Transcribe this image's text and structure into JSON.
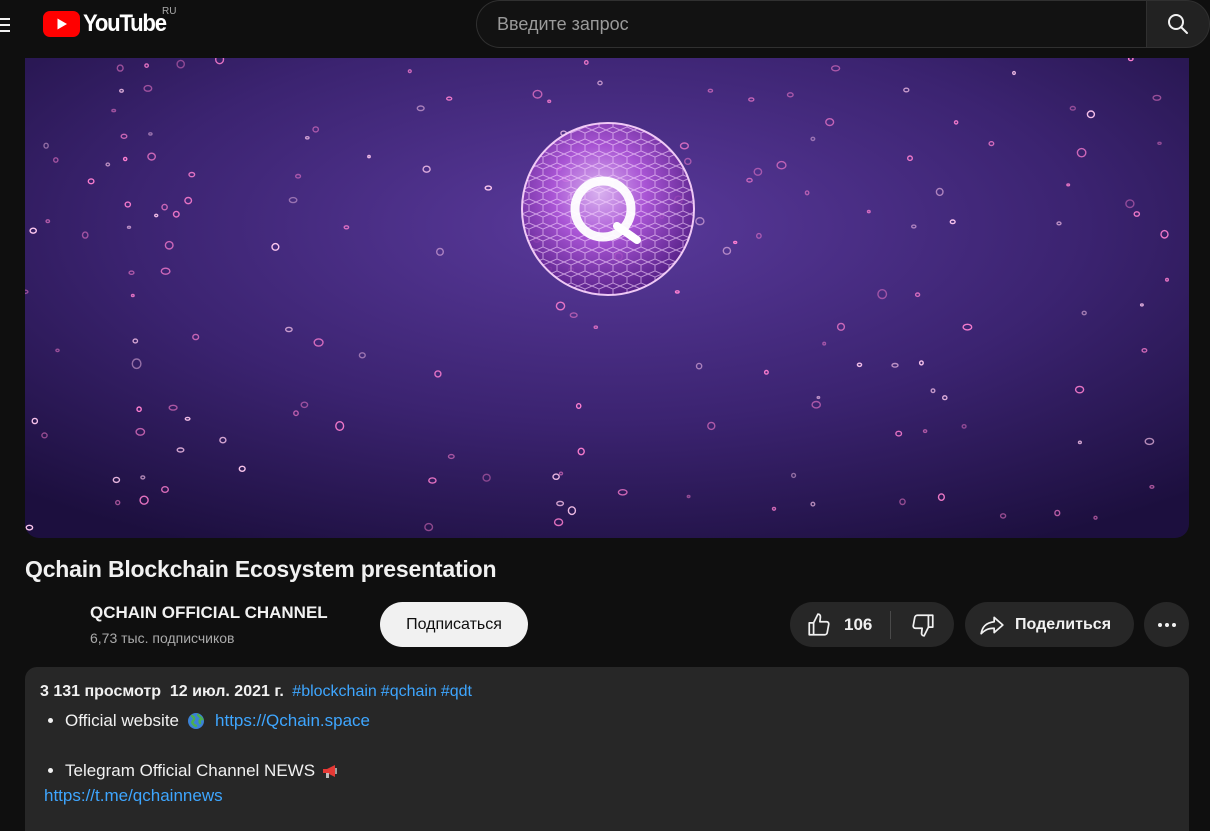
{
  "header": {
    "logo_text": "YouTube",
    "region": "RU",
    "search_placeholder": "Введите запрос"
  },
  "video": {
    "title": "Qchain Blockchain Ecosystem presentation"
  },
  "channel": {
    "name": "QCHAIN OFFICIAL CHANNEL",
    "subscribers": "6,73 тыс. подписчиков",
    "subscribe_label": "Подписаться"
  },
  "actions": {
    "like_count": "106",
    "share_label": "Поделиться"
  },
  "description": {
    "views": "3 131 просмотр",
    "date": "12 июл. 2021 г.",
    "hashtags": [
      "#blockchain",
      "#qchain",
      "#qdt"
    ],
    "line1_label": "Official website",
    "line1_link": "https://Qchain.space",
    "line2_label": "Telegram Official Channel NEWS",
    "line2_link": "https://t.me/qchainnews"
  },
  "colors": {
    "background": "#0f0f0f",
    "surface": "#272727",
    "link": "#3ea6ff",
    "brand_red": "#ff0000"
  },
  "icons": [
    "menu-icon",
    "youtube-logo-icon",
    "search-icon",
    "thumb-up-icon",
    "thumb-down-icon",
    "share-icon",
    "more-icon",
    "globe-emoji-icon",
    "megaphone-emoji-icon"
  ]
}
